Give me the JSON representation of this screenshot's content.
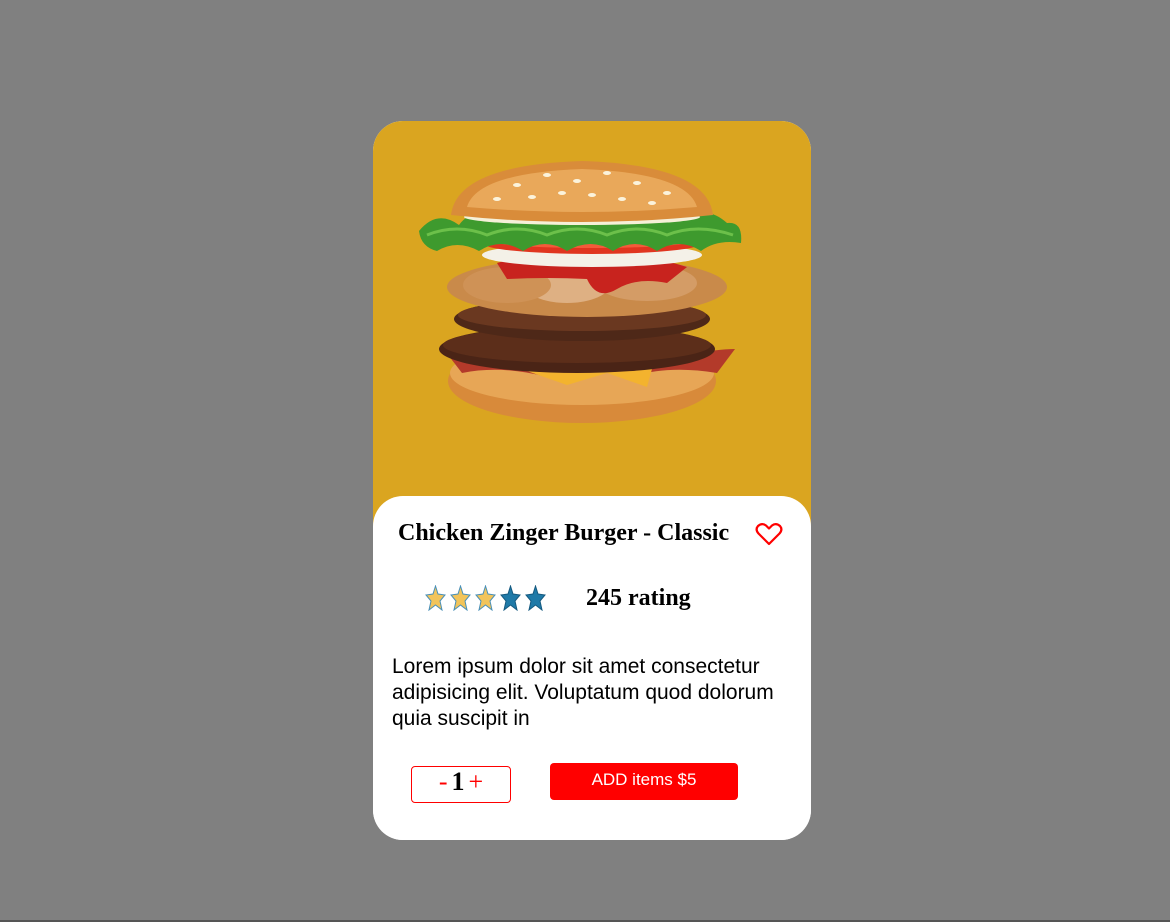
{
  "product": {
    "title": "Chicken Zinger Burger - Classic",
    "image_icon": "burger-image",
    "favorite_icon": "heart-icon"
  },
  "rating": {
    "stars_filled": 3,
    "stars_total": 5,
    "label": "245 rating"
  },
  "description": "Lorem ipsum dolor sit amet consectetur adipisicing elit. Voluptatum quod dolorum quia suscipit in",
  "quantity": {
    "minus_label": "-",
    "value": "1",
    "plus_label": "+"
  },
  "cart": {
    "add_label": "ADD items $5"
  },
  "colors": {
    "background": "#808080",
    "hero": "#daa520",
    "accent": "#ff0000",
    "star_gold": "#f2c45a",
    "star_blue": "#1f7aa8"
  }
}
